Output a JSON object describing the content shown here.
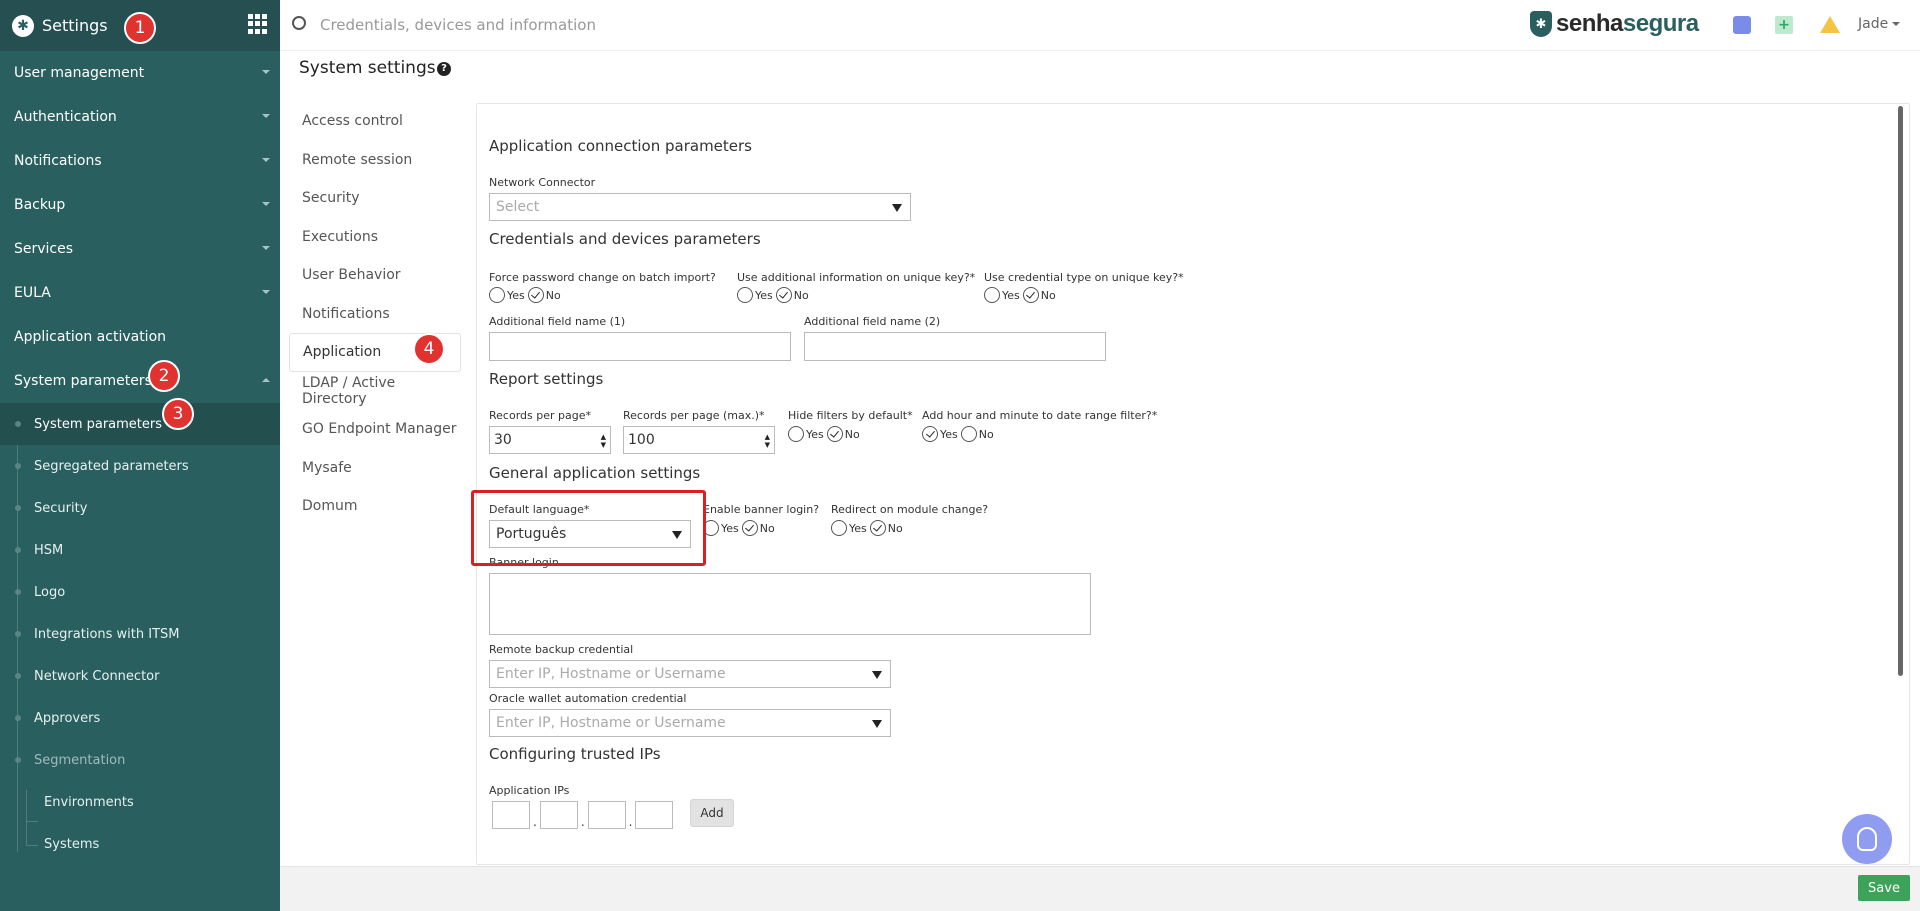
{
  "sidebar": {
    "title": "Settings",
    "items": [
      {
        "label": "User management"
      },
      {
        "label": "Authentication"
      },
      {
        "label": "Notifications"
      },
      {
        "label": "Backup"
      },
      {
        "label": "Services"
      },
      {
        "label": "EULA"
      },
      {
        "label": "Application activation"
      },
      {
        "label": "System parameters"
      }
    ],
    "subitems": [
      {
        "label": "System parameters"
      },
      {
        "label": "Segregated parameters"
      },
      {
        "label": "Security"
      },
      {
        "label": "HSM"
      },
      {
        "label": "Logo"
      },
      {
        "label": "Integrations with ITSM"
      },
      {
        "label": "Network Connector"
      },
      {
        "label": "Approvers"
      },
      {
        "label": "Segmentation"
      }
    ],
    "segmentation_children": [
      {
        "label": "Environments"
      },
      {
        "label": "Systems"
      }
    ]
  },
  "badges": [
    "1",
    "2",
    "3",
    "4"
  ],
  "topbar": {
    "search_placeholder": "Credentials, devices and information",
    "brand_prefix": "senha",
    "brand_suffix": "segura",
    "user": "Jade"
  },
  "page": {
    "title": "System settings",
    "help": "?"
  },
  "nav": [
    {
      "label": "Access control"
    },
    {
      "label": "Remote session"
    },
    {
      "label": "Security"
    },
    {
      "label": "Executions"
    },
    {
      "label": "User Behavior"
    },
    {
      "label": "Notifications"
    },
    {
      "label": "Application"
    },
    {
      "label": "LDAP / Active Directory"
    },
    {
      "label": "GO Endpoint Manager"
    },
    {
      "label": "Mysafe"
    },
    {
      "label": "Domum"
    }
  ],
  "form": {
    "app_conn": {
      "title": "Application connection parameters",
      "network_connector_label": "Network Connector",
      "network_connector_value": "Select"
    },
    "cred_dev": {
      "title": "Credentials and devices parameters",
      "force_pwd_label": "Force password change on batch import?",
      "use_info_label": "Use additional information on unique key?*",
      "use_type_label": "Use credential type on unique key?*",
      "field1_label": "Additional field name (1)",
      "field2_label": "Additional field name (2)"
    },
    "report": {
      "title": "Report settings",
      "records_label": "Records per page*",
      "records_value": "30",
      "records_max_label": "Records per page (max.)*",
      "records_max_value": "100",
      "hide_filters_label": "Hide filters by default*",
      "add_hour_label": "Add hour and minute to date range filter?*"
    },
    "general": {
      "title": "General application settings",
      "lang_label": "Default language*",
      "lang_value": "Português",
      "banner_label": "Enable banner login?",
      "redirect_label": "Redirect on module change?",
      "banner_text_label": "Banner login",
      "remote_backup_label": "Remote backup credential",
      "remote_backup_placeholder": "Enter IP, Hostname or Username",
      "oracle_label": "Oracle wallet automation credential",
      "oracle_placeholder": "Enter IP, Hostname or Username"
    },
    "trusted": {
      "title": "Configuring trusted IPs",
      "ips_label": "Application IPs",
      "add": "Add"
    },
    "yes": "Yes",
    "no": "No"
  },
  "footer": {
    "save": "Save"
  }
}
